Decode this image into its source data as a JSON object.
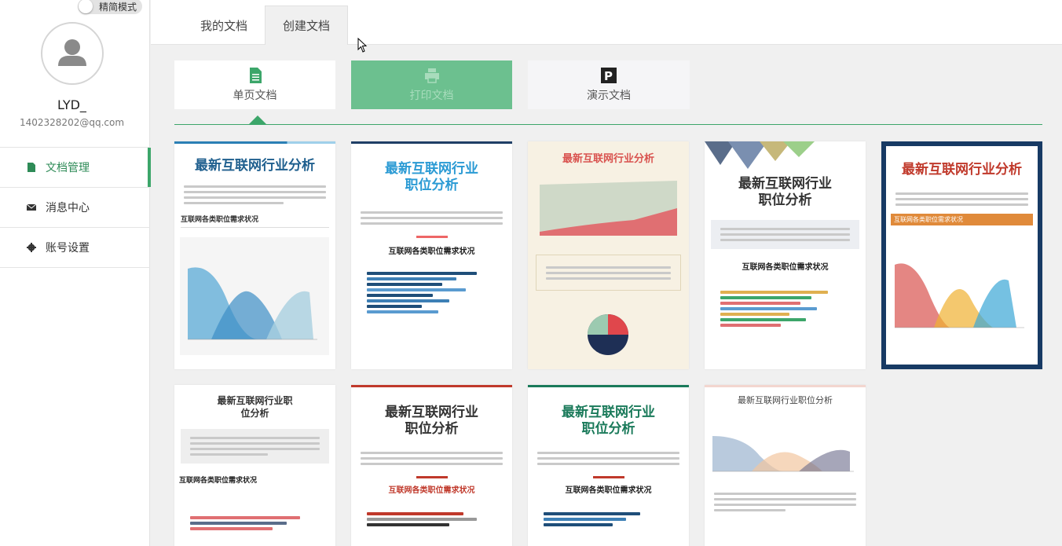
{
  "sidebar": {
    "toggle_label": "精简模式",
    "username": "LYD_",
    "email": "1402328202@qq.com",
    "nav": [
      {
        "label": "文档管理",
        "icon": "document-icon",
        "active": true
      },
      {
        "label": "消息中心",
        "icon": "envelope-icon",
        "active": false
      },
      {
        "label": "账号设置",
        "icon": "gear-icon",
        "active": false
      }
    ]
  },
  "tabs": [
    {
      "label": "我的文档",
      "active": false
    },
    {
      "label": "创建文档",
      "active": true
    }
  ],
  "categories": [
    {
      "label": "单页文档",
      "icon": "document-icon",
      "selected": true
    },
    {
      "label": "打印文档",
      "icon": "printer-icon",
      "selected": false
    },
    {
      "label": "演示文档",
      "icon": "presentation-icon",
      "selected": false
    }
  ],
  "templates": [
    {
      "title": "最新互联网行业分析",
      "subtitle": "互联网各类职位需求状况",
      "accent": "#2b7fb5"
    },
    {
      "title": "最新互联网行业职位分析",
      "subtitle": "互联网各类职位需求状况",
      "accent": "#1f4e79"
    },
    {
      "title": "最新互联网行业分析",
      "subtitle": "",
      "accent": "#d9534f"
    },
    {
      "title": "最新互联网行业职位分析",
      "subtitle": "互联网各类职位需求状况",
      "accent": "#4a5a7a"
    },
    {
      "title": "最新互联网行业分析",
      "subtitle": "互联网各类职位需求状况",
      "accent": "#c0392b"
    },
    {
      "title": "最新互联网行业职位分析",
      "subtitle": "互联网各类职位需求状况",
      "accent": "#333333"
    },
    {
      "title": "最新互联网行业职位分析",
      "subtitle": "互联网各类职位需求状况",
      "accent": "#c0392b"
    },
    {
      "title": "最新互联网行业职位分析",
      "subtitle": "互联网各类职位需求状况",
      "accent": "#1a7a5a"
    },
    {
      "title": "最新互联网行业职位分析",
      "subtitle": "",
      "accent": "#555555"
    }
  ],
  "colors": {
    "brand_green": "#3ca66a",
    "print_bg": "#6cc08f"
  }
}
